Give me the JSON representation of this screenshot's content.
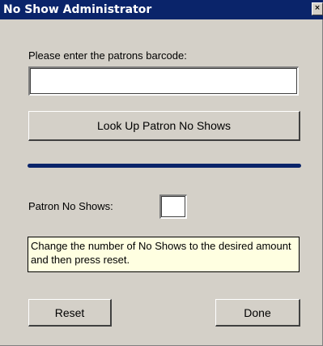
{
  "window": {
    "title": "No Show Administrator",
    "close_glyph": "×"
  },
  "barcode": {
    "label": "Please enter the patrons barcode:",
    "value": "",
    "placeholder": ""
  },
  "lookup_button": {
    "label": "Look Up Patron No Shows"
  },
  "no_shows": {
    "label": "Patron No Shows:",
    "value": ""
  },
  "info": {
    "text": "Change the number of No Shows to the desired amount and then press reset."
  },
  "buttons": {
    "reset_label": "Reset",
    "done_label": "Done"
  },
  "colors": {
    "titlebar": "#0a246a",
    "face": "#d4d0c8",
    "separator": "#0a246a",
    "info_background": "#ffffe1"
  }
}
